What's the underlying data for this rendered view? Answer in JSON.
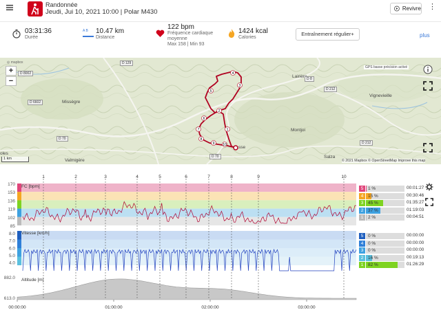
{
  "header": {
    "title": "Randonnée",
    "subtitle": "Jeudi, Jui 10, 2021 10:00 | Polar M430",
    "replay_label": "Revivre"
  },
  "summary": {
    "duration": {
      "value": "03:31:36",
      "label": "Durée"
    },
    "distance": {
      "value": "10.47 km",
      "label": "Distance",
      "icon_text": "A  B"
    },
    "heart": {
      "value": "122 bpm",
      "label": "Fréquence cardiaque moyenne",
      "minmax": "Max 158 | Min 93"
    },
    "calories": {
      "value": "1424 kcal",
      "label": "Calories"
    },
    "training_button": "Entraînement régulier+",
    "more_link": "plus"
  },
  "map": {
    "places": [
      "Lairière",
      "Missègre",
      "Vignevieille",
      "Montjoi",
      "Valmigère",
      "Salza",
      "oles",
      "sse"
    ],
    "roads": [
      "D 129",
      "D 212",
      "D 8",
      "D 6602",
      "D 70",
      "D 70",
      "D 212",
      "D 8002"
    ],
    "gps_label": "GPS basse précision activé",
    "scale": "1 km",
    "attribution": "© 2021 Mapbox © OpenStreetMap Improve this map",
    "route_marks": [
      "1",
      "2",
      "3",
      "4",
      "5",
      "6",
      "7",
      "8",
      "9",
      "10"
    ]
  },
  "charts": {
    "hr": {
      "label": "FC [bpm]",
      "yticks": [
        "170",
        "153",
        "136",
        "119",
        "102",
        "85"
      ],
      "zones": [
        {
          "zone": "5",
          "pct": "1 %",
          "time": "00:01:27",
          "color": "#e0457b",
          "frac": 0.01
        },
        {
          "zone": "4",
          "pct": "15 %",
          "time": "00:30:46",
          "color": "#f5a623",
          "frac": 0.15
        },
        {
          "zone": "3",
          "pct": "45 %",
          "time": "01:35:27",
          "color": "#7ed321",
          "frac": 0.45
        },
        {
          "zone": "2",
          "pct": "37 %",
          "time": "01:19:03",
          "color": "#3ea1e0",
          "frac": 0.37
        },
        {
          "zone": "1",
          "pct": "2 %",
          "time": "00:04:51",
          "color": "#bbbbbb",
          "frac": 0.02
        }
      ]
    },
    "speed": {
      "label": "Vitesse [km/h]",
      "yticks": [
        "8.0",
        "7.0",
        "6.0",
        "5.0",
        "4.0"
      ],
      "zones": [
        {
          "zone": "5",
          "pct": "0 %",
          "time": "00:00:00",
          "color": "#1f5fbf",
          "frac": 0.0
        },
        {
          "zone": "4",
          "pct": "0 %",
          "time": "00:00:00",
          "color": "#2f7fd8",
          "frac": 0.0
        },
        {
          "zone": "3",
          "pct": "0 %",
          "time": "00:00:00",
          "color": "#3ea1e0",
          "frac": 0.0
        },
        {
          "zone": "2",
          "pct": "16 %",
          "time": "00:19:13",
          "color": "#5bc0de",
          "frac": 0.16
        },
        {
          "zone": "1",
          "pct": "82 %",
          "time": "01:26:29",
          "color": "#7ed321",
          "frac": 0.82
        }
      ]
    },
    "altitude": {
      "label": "Altitude [m]",
      "yticks": [
        "882.0",
        "613.0"
      ]
    },
    "laps": [
      "1",
      "2",
      "3",
      "4",
      "5",
      "6",
      "7",
      "8",
      "9",
      "10"
    ],
    "xticks": [
      "00:00:00",
      "01:00:00",
      "02:00:00",
      "03:00:00"
    ]
  }
}
